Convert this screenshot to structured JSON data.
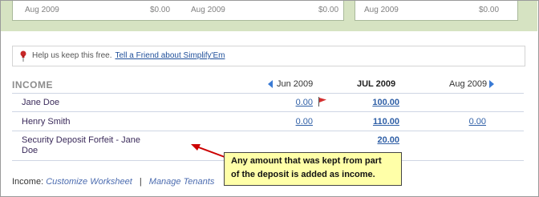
{
  "top_panels": {
    "left": {
      "labels": [
        "Aug 2009",
        "$0.00",
        "Aug 2009",
        "$0.00"
      ]
    },
    "right": {
      "labels": [
        "Aug 2009",
        "$0.00"
      ]
    }
  },
  "help": {
    "text": "Help us keep this free.",
    "link": "Tell a Friend about Simplify'Em"
  },
  "income": {
    "title": "INCOME",
    "months": {
      "prev": "Jun 2009",
      "current": "JUL 2009",
      "next": "Aug 2009"
    },
    "rows": [
      {
        "name": "Jane Doe",
        "prev": "0.00",
        "current": "100.00",
        "next": ""
      },
      {
        "name": "Henry Smith",
        "prev": "0.00",
        "current": "110.00",
        "next": "0.00"
      },
      {
        "name": "Security Deposit Forfeit - Jane Doe",
        "name_line1": "Security Deposit Forfeit - Jane",
        "name_line2": "Doe",
        "prev": "",
        "current": "20.00",
        "next": ""
      }
    ]
  },
  "callout": {
    "line1": "Any amount that was kept from part",
    "line2": "of the deposit is added as income."
  },
  "footer": {
    "label": "Income:",
    "link1": "Customize Worksheet",
    "separator": "|",
    "link2": "Manage Tenants"
  },
  "colors": {
    "link": "#2f5fa6",
    "callout_bg": "#ffffa8",
    "band": "#d6e3c2",
    "arrow": "#cc0000"
  },
  "icons": [
    "pushpin-icon",
    "red-flag-icon",
    "previous-month-arrow-icon",
    "next-month-arrow-icon"
  ]
}
